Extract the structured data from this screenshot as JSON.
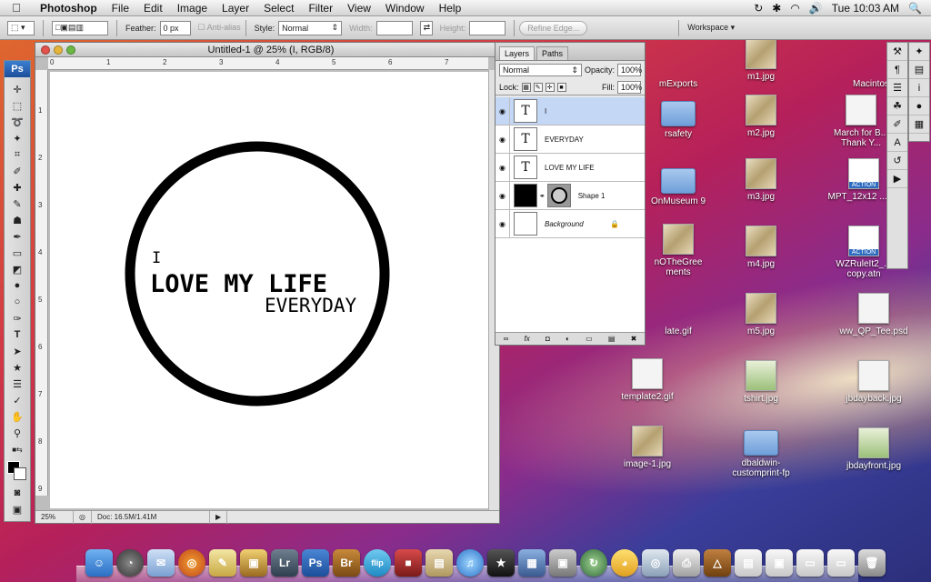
{
  "menubar": {
    "app": "Photoshop",
    "menus": [
      "File",
      "Edit",
      "Image",
      "Layer",
      "Select",
      "Filter",
      "View",
      "Window",
      "Help"
    ],
    "clock": "Tue 10:03 AM"
  },
  "options": {
    "feather_label": "Feather:",
    "feather_value": "0 px",
    "antialias_label": "Anti-alias",
    "style_label": "Style:",
    "style_value": "Normal",
    "width_label": "Width:",
    "height_label": "Height:",
    "refine_label": "Refine Edge...",
    "workspace_label": "Workspace"
  },
  "tools": {
    "logo": "Ps"
  },
  "document": {
    "title": "Untitled-1 @ 25% (I, RGB/8)",
    "zoom": "25%",
    "doc_info": "Doc: 16.5M/1.41M",
    "ruler_h": [
      "0",
      "1",
      "2",
      "3",
      "4",
      "5",
      "6",
      "7"
    ],
    "ruler_v": [
      "1",
      "2",
      "3",
      "4",
      "5",
      "6",
      "7",
      "8",
      "9"
    ],
    "text_i": "I",
    "text_love": "LOVE MY LIFE",
    "text_everyday": "EVERYDAY"
  },
  "layers_panel": {
    "tab_layers": "Layers",
    "tab_paths": "Paths",
    "blend_mode": "Normal",
    "opacity_label": "Opacity:",
    "opacity_value": "100%",
    "lock_label": "Lock:",
    "fill_label": "Fill:",
    "fill_value": "100%",
    "layers": [
      {
        "name": "I",
        "thumb": "T"
      },
      {
        "name": "EVERYDAY",
        "thumb": "T"
      },
      {
        "name": "LOVE MY LIFE",
        "thumb": "T"
      },
      {
        "name": "Shape 1",
        "thumb": ""
      },
      {
        "name": "Background",
        "thumb": ""
      }
    ]
  },
  "desktop_icons": [
    {
      "label": "mExports"
    },
    {
      "label": "m1.jpg"
    },
    {
      "label": "Macintos"
    },
    {
      "label": "rsafety"
    },
    {
      "label": "m2.jpg"
    },
    {
      "label": "March for B... Thank Y..."
    },
    {
      "label": "OnMuseum 9"
    },
    {
      "label": "m3.jpg"
    },
    {
      "label": "MPT_12x12 ...atn"
    },
    {
      "label": "nOTheGree ments"
    },
    {
      "label": "m4.jpg"
    },
    {
      "label": "WZRuleIt2_... copy.atn"
    },
    {
      "label": "late.gif"
    },
    {
      "label": "m5.jpg"
    },
    {
      "label": "ww_QP_Tee.psd"
    },
    {
      "label": "template2.gif"
    },
    {
      "label": "tshirt.jpg"
    },
    {
      "label": "jbdayback.jpg"
    },
    {
      "label": "image-1.jpg"
    },
    {
      "label": "dbaldwin-customprint-fp"
    },
    {
      "label": "jbdayfront.jpg"
    }
  ],
  "dock": {
    "lr": "Lr",
    "ps": "Ps",
    "br": "Br",
    "flip": "flip"
  },
  "colors": {
    "selection": "#c4d8f6",
    "ps_blue": "#1c4e9a"
  }
}
